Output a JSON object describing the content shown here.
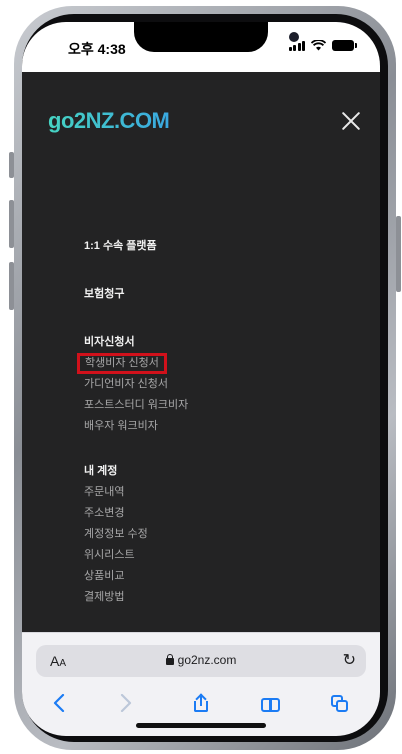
{
  "status_bar": {
    "time": "오후 4:38"
  },
  "header": {
    "logo": "go2NZ.COM",
    "close_icon": "close-icon"
  },
  "menu": {
    "top_items": [
      "1:1 수속 플랫폼",
      "보험청구"
    ],
    "visa_section": {
      "heading": "비자신청서",
      "items": [
        "학생비자 신청서",
        "가디언비자 신청서",
        "포스트스터디 워크비자",
        "배우자 워크비자"
      ],
      "highlighted_item": "학생비자 신청서",
      "highlight_color": "#d1111b"
    },
    "account_section": {
      "heading": "내 계정",
      "items": [
        "주문내역",
        "주소변경",
        "계정정보 수정",
        "위시리스트",
        "상품비교",
        "결제방법"
      ]
    }
  },
  "browser": {
    "text_size_label": "AA",
    "url": "go2nz.com",
    "reload_icon": "reload-icon",
    "toolbar_icons": [
      "back-icon",
      "forward-icon",
      "share-icon",
      "bookmarks-icon",
      "tabs-icon"
    ]
  },
  "colors": {
    "menu_background": "#232324",
    "accent_blue": "#1c7cf4",
    "logo_gradient_start": "#46d3c2",
    "logo_gradient_end": "#3aa8e0"
  }
}
